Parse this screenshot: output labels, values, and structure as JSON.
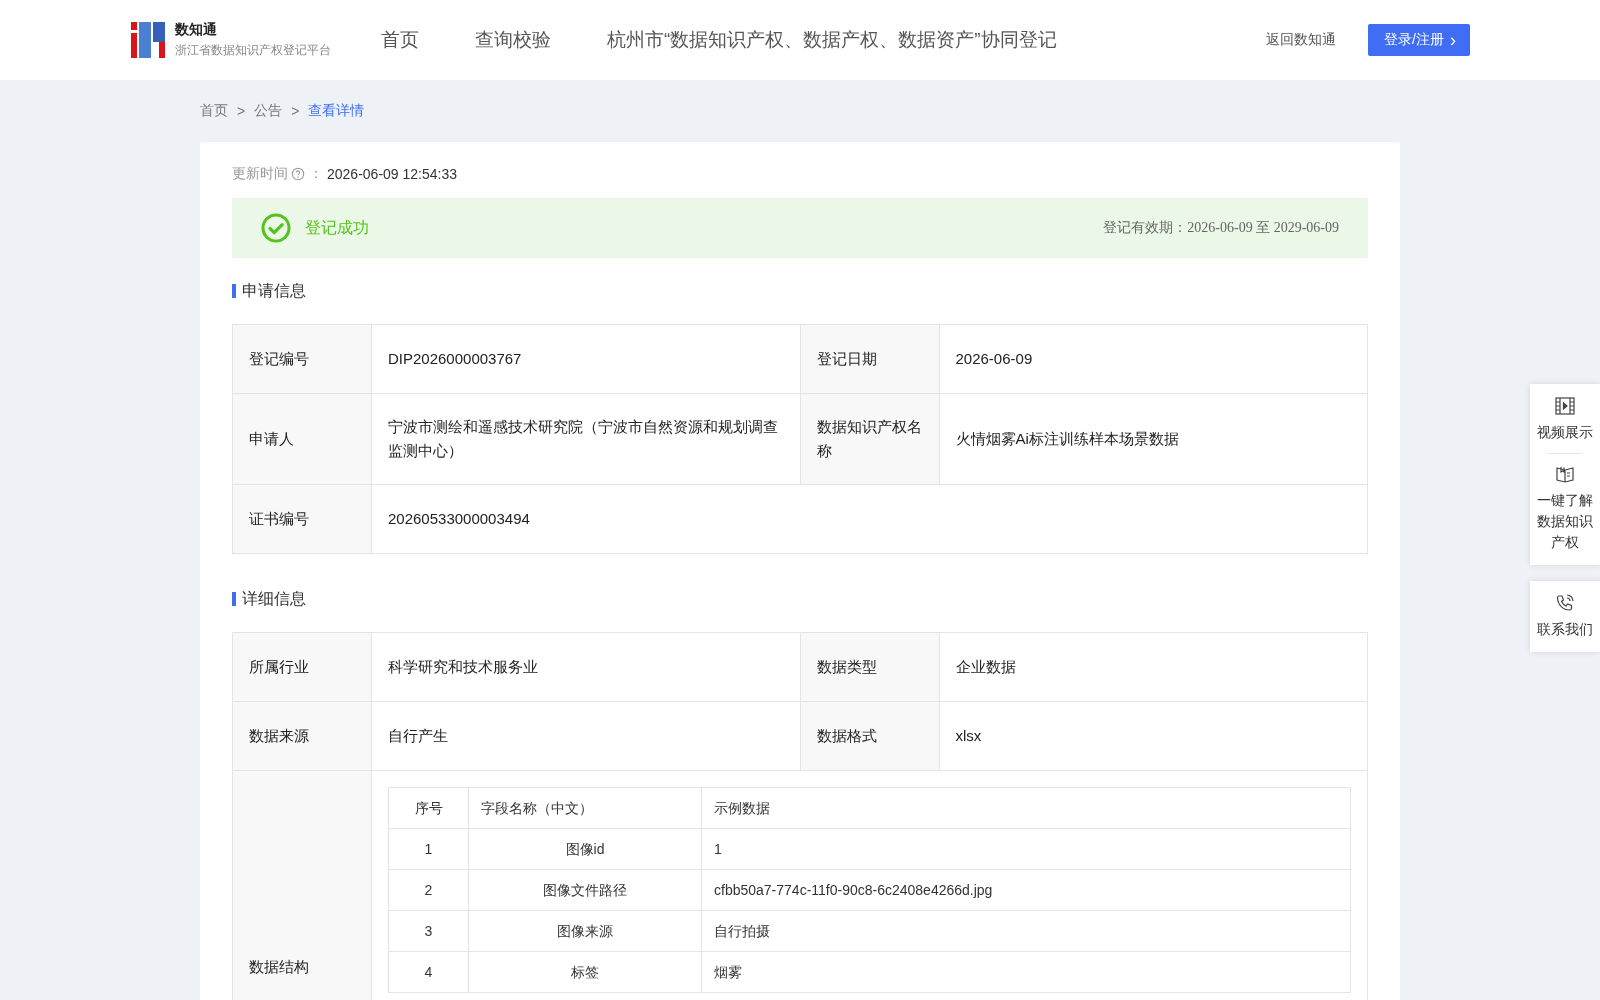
{
  "header": {
    "logo_title": "数知通",
    "logo_subtitle": "浙江省数据知识产权登记平台",
    "nav": [
      "首页",
      "查询校验",
      "杭州市“数据知识产权、数据产权、数据资产”协同登记"
    ],
    "back_link": "返回数知通",
    "login_button": "登录/注册",
    "login_caret": "›"
  },
  "breadcrumb": [
    {
      "kind": "link",
      "label": "首页",
      "current": false
    },
    {
      "kind": "separator",
      "label": ">"
    },
    {
      "kind": "link",
      "label": "公告",
      "current": false
    },
    {
      "kind": "separator",
      "label": ">"
    },
    {
      "kind": "link",
      "label": "查看详情",
      "current": true
    }
  ],
  "update": {
    "label": "更新时间",
    "colon": "：",
    "value": "2026-06-09 12:54:33"
  },
  "status": {
    "success": true,
    "text": "登记成功",
    "validity": "登记有效期：2026-06-09 至 2029-06-09"
  },
  "sections": [
    {
      "title": "申请信息",
      "rows": [
        {
          "kind": "pairs",
          "cells": [
            {
              "label": "登记编号",
              "value": "DIP2026000003767"
            },
            {
              "label": "登记日期",
              "value": "2026-06-09"
            }
          ]
        },
        {
          "kind": "pairs",
          "cells": [
            {
              "label": "申请人",
              "value": "宁波市测绘和遥感技术研究院（宁波市自然资源和规划调查监测中心）"
            },
            {
              "label": "数据知识产权名称",
              "value": "火情烟雾Ai标注训练样本场景数据"
            }
          ]
        },
        {
          "kind": "pairs",
          "cells": [
            {
              "label": "证书编号",
              "value": "20260533000003494"
            }
          ]
        }
      ]
    },
    {
      "title": "详细信息",
      "rows": [
        {
          "kind": "pairs",
          "cells": [
            {
              "label": "所属行业",
              "value": "科学研究和技术服务业"
            },
            {
              "label": "数据类型",
              "value": "企业数据"
            }
          ]
        },
        {
          "kind": "pairs",
          "cells": [
            {
              "label": "数据来源",
              "value": "自行产生"
            },
            {
              "label": "数据格式",
              "value": "xlsx"
            }
          ]
        },
        {
          "kind": "structure",
          "label": "数据结构",
          "columns": [
            "序号",
            "字段名称（中文）",
            "示例数据"
          ],
          "rows": [
            [
              "1",
              "图像id",
              "1"
            ],
            [
              "2",
              "图像文件路径",
              "cfbb50a7-774c-11f0-90c8-6c2408e4266d.jpg"
            ],
            [
              "3",
              "图像来源",
              "自行拍摄"
            ],
            [
              "4",
              "标签",
              "烟雾"
            ]
          ]
        }
      ]
    }
  ],
  "side_panel": [
    {
      "kind": "video",
      "label": "视频展示"
    },
    {
      "kind": "book",
      "label": "一键了解数据知识产权"
    },
    {
      "kind": "phone",
      "label": "联系我们"
    }
  ]
}
